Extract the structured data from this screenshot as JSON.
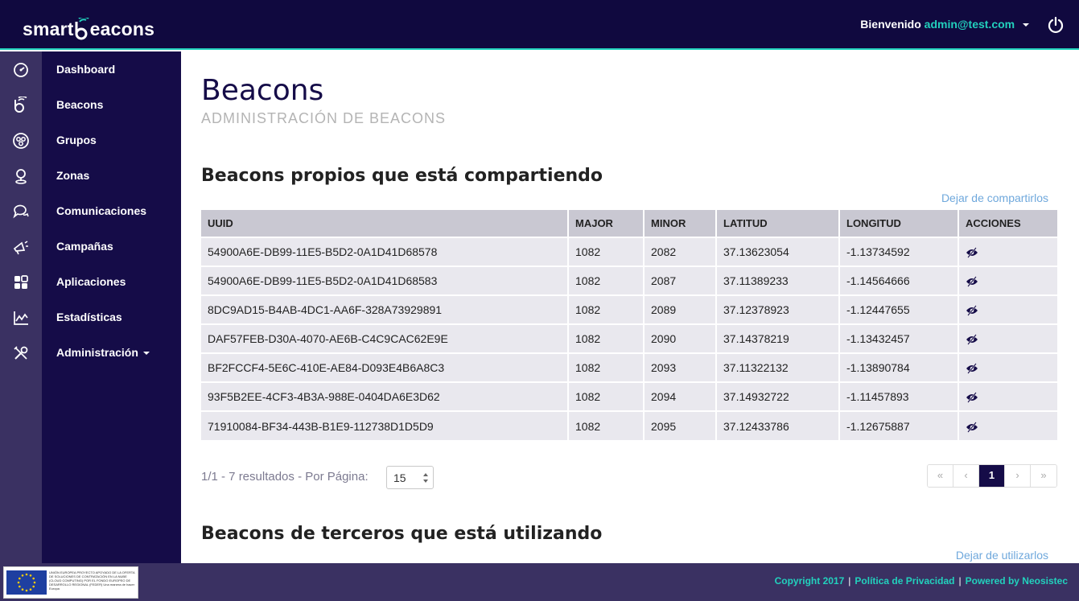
{
  "app": {
    "logo_left": "smart",
    "logo_right": "eacons"
  },
  "header": {
    "welcome_label": "Bienvenido",
    "user_email": "admin@test.com"
  },
  "sidebar": {
    "items": [
      {
        "label": "Dashboard",
        "icon": "dashboard-icon"
      },
      {
        "label": "Beacons",
        "icon": "beacon-icon"
      },
      {
        "label": "Grupos",
        "icon": "groups-icon"
      },
      {
        "label": "Zonas",
        "icon": "zone-pin-icon"
      },
      {
        "label": "Comunicaciones",
        "icon": "chat-icon"
      },
      {
        "label": "Campañas",
        "icon": "megaphone-icon"
      },
      {
        "label": "Aplicaciones",
        "icon": "apps-grid-icon"
      },
      {
        "label": "Estadísticas",
        "icon": "stats-chart-icon"
      },
      {
        "label": "Administración",
        "icon": "tools-icon"
      }
    ]
  },
  "main": {
    "title": "Beacons",
    "subtitle": "ADMINISTRACIÓN DE BEACONS",
    "own_section_title": "Beacons propios que está compartiendo",
    "own_action": "Dejar de compartirlos",
    "third_section_title": "Beacons de terceros que está utilizando",
    "third_action": "Dejar de utilizarlos"
  },
  "table": {
    "columns": [
      "UUID",
      "MAJOR",
      "MINOR",
      "LATITUD",
      "LONGITUD",
      "ACCIONES"
    ],
    "rows": [
      [
        "54900A6E-DB99-11E5-B5D2-0A1D41D68578",
        "1082",
        "2082",
        "37.13623054",
        "-1.13734592"
      ],
      [
        "54900A6E-DB99-11E5-B5D2-0A1D41D68583",
        "1082",
        "2087",
        "37.11389233",
        "-1.14564666"
      ],
      [
        "8DC9AD15-B4AB-4DC1-AA6F-328A73929891",
        "1082",
        "2089",
        "37.12378923",
        "-1.12447655"
      ],
      [
        "DAF57FEB-D30A-4070-AE6B-C4C9CAC62E9E",
        "1082",
        "2090",
        "37.14378219",
        "-1.13432457"
      ],
      [
        "BF2FCCF4-5E6C-410E-AE84-D093E4B6A8C3",
        "1082",
        "2093",
        "37.11322132",
        "-1.13890784"
      ],
      [
        "93F5B2EE-4CF3-4B3A-988E-0404DA6E3D62",
        "1082",
        "2094",
        "37.14932722",
        "-1.11457893"
      ],
      [
        "71910084-BF34-443B-B1E9-112738D1D5D9",
        "1082",
        "2095",
        "37.12433786",
        "-1.12675887"
      ]
    ]
  },
  "pager": {
    "info": "1/1 - 7 resultados - Por Página:",
    "per_page": "15",
    "first": "«",
    "prev": "‹",
    "current": "1",
    "next": "›",
    "last": "»"
  },
  "footer": {
    "copyright": "Copyright 2017",
    "privacy": "Política de Privacidad",
    "powered": "Powered by Neosistec",
    "eu_text": "UNIÓN EUROPEA PROYECTO APOYADO DE LA OFERTA DE SOLUCIONES DE CONTRATACIÓN EN LA NUBE (CLOUD COMPUTING) POR EL FONDO EUROPEO DE DESARROLLO REGIONAL (FEDER) Una manera de hacer Europa"
  },
  "colors": {
    "navy": "#150c48",
    "teal": "#22d1bd",
    "rail": "#3a3162",
    "link": "#6fa8dc"
  }
}
